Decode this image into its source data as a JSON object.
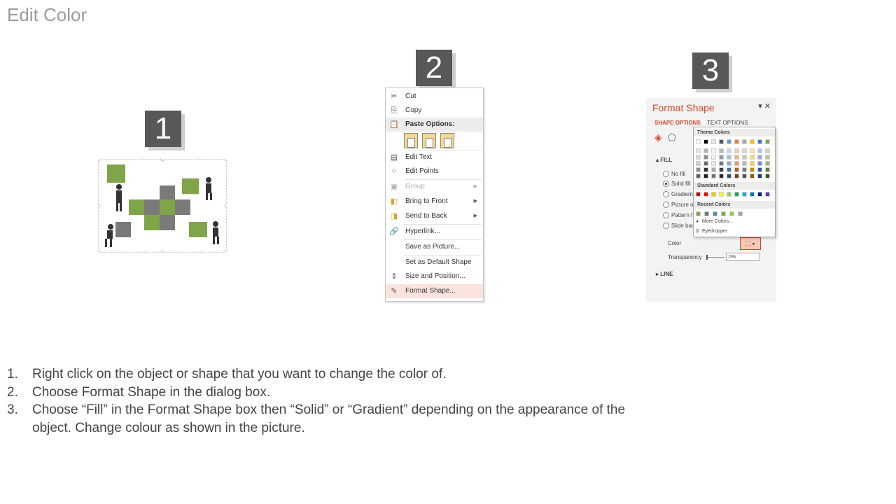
{
  "title": "Edit Color",
  "steps": [
    "1",
    "2",
    "3"
  ],
  "context_menu": {
    "items": [
      {
        "label": "Cut",
        "icon": "scissors-icon"
      },
      {
        "label": "Copy",
        "icon": "copy-icon"
      },
      {
        "label": "Paste Options:",
        "icon": "paste-icon"
      },
      {
        "label": "Edit Text",
        "icon": "text-box-icon"
      },
      {
        "label": "Edit Points",
        "icon": "edit-points-icon"
      },
      {
        "label": "Group",
        "icon": "group-icon"
      },
      {
        "label": "Bring to Front",
        "icon": "bring-front-icon"
      },
      {
        "label": "Send to Back",
        "icon": "send-back-icon"
      },
      {
        "label": "Hyperlink...",
        "icon": "link-icon"
      },
      {
        "label": "Save as Picture..."
      },
      {
        "label": "Set as Default Shape"
      },
      {
        "label": "Size and Position...",
        "icon": "size-position-icon"
      },
      {
        "label": "Format Shape...",
        "icon": "format-shape-icon"
      }
    ]
  },
  "format_pane": {
    "title": "Format Shape",
    "tabs": [
      "SHAPE OPTIONS",
      "TEXT OPTIONS"
    ],
    "section_fill": "FILL",
    "fill_options": [
      "No fill",
      "Solid fill",
      "Gradient",
      "Picture o",
      "Pattern f",
      "Slide bac"
    ],
    "color_label": "Color",
    "transparency_label": "Transparency",
    "transparency_value": "0%",
    "section_line": "LINE",
    "palette": {
      "theme_label": "Theme Colors",
      "standard_label": "Standard Colors",
      "recent_label": "Recent Colors",
      "more_colors": "More Colors...",
      "eyedropper": "Eyedropper",
      "theme_colors": [
        "#ffffff",
        "#000000",
        "#e7e6e6",
        "#44546a",
        "#5b9bd5",
        "#ed7d31",
        "#a5a5a5",
        "#ffc000",
        "#4472c4",
        "#70ad47"
      ],
      "standard_colors": [
        "#c00000",
        "#ff0000",
        "#ffc000",
        "#ffff00",
        "#92d050",
        "#00b050",
        "#00b0f0",
        "#0070c0",
        "#002060",
        "#7030a0"
      ],
      "recent_colors": [
        "#7ea548",
        "#707070",
        "#4a8db7",
        "#7ea548",
        "#92d050",
        "#a5a5a5"
      ]
    }
  },
  "instructions": [
    {
      "num": "1.",
      "text": "Right click on the object or shape that you want to change the color of."
    },
    {
      "num": "2.",
      "text": "Choose Format Shape in the dialog box."
    },
    {
      "num": "3.",
      "text": "Choose “Fill” in the Format Shape box then “Solid” or “Gradient” depending  on the appearance of the object. Change colour as shown in the picture."
    }
  ],
  "colors": {
    "accent": "#d24726",
    "badge": "#585858",
    "puzzle_green": "#7ea548",
    "puzzle_gray": "#7a7a7a"
  }
}
